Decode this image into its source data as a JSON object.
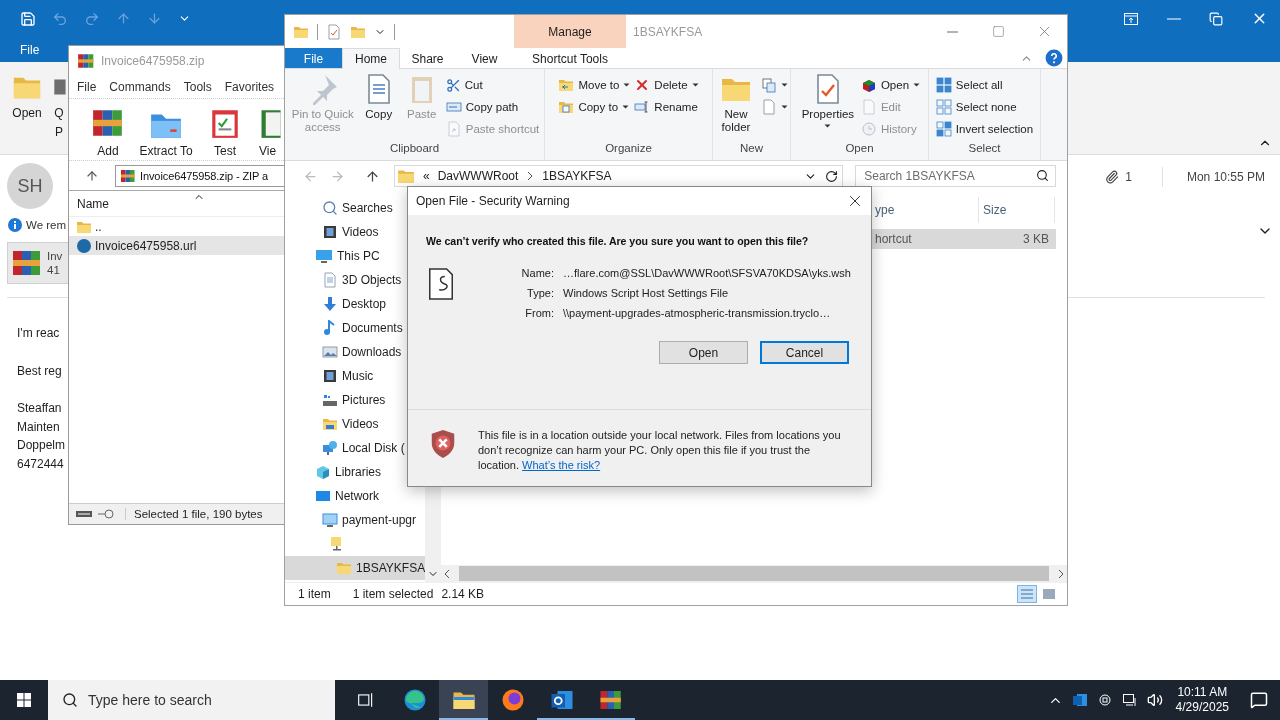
{
  "outlook": {
    "menu_tab": "File",
    "ribbon_buttons": [
      {
        "lines": [
          "Open"
        ]
      },
      {
        "lines": [
          "Q",
          "P"
        ]
      }
    ],
    "message": {
      "sender_initials": "SH",
      "notice": "We rem",
      "attachment": {
        "name": "Inv",
        "size": "41"
      },
      "attachment_count": "1",
      "received": "Mon 10:55 PM",
      "body": [
        [
          "I'm reac"
        ],
        [
          "Best reg"
        ],
        [
          "Steaffan",
          "Mainten",
          "Doppelm",
          "6472444"
        ]
      ]
    }
  },
  "winrar": {
    "title": "Invoice6475958.zip",
    "menu": [
      "File",
      "Commands",
      "Tools",
      "Favorites"
    ],
    "toolbar": [
      "Add",
      "Extract To",
      "Test",
      "Vie"
    ],
    "path": "Invoice6475958.zip - ZIP a",
    "columns": [
      "Name"
    ],
    "rows": [
      {
        "name": "..",
        "selected": false
      },
      {
        "name": "Invoice6475958.url",
        "selected": true
      }
    ],
    "status": "Selected 1 file, 190 bytes"
  },
  "explorer": {
    "context_tab": "Manage",
    "title": "1BSAYKFSA",
    "tabs": [
      {
        "label": "File",
        "kind": "file",
        "selected": false
      },
      {
        "label": "Home",
        "kind": "tab",
        "selected": true
      },
      {
        "label": "Share",
        "kind": "tab",
        "selected": false
      },
      {
        "label": "View",
        "kind": "tab",
        "selected": false
      },
      {
        "label": "Shortcut Tools",
        "kind": "tab",
        "selected": false
      }
    ],
    "groups": [
      {
        "label": "Clipboard",
        "items": [
          {
            "kind": "large",
            "label": "Pin to Quick access",
            "disabled": true
          },
          {
            "kind": "large",
            "label": "Copy",
            "disabled": false
          },
          {
            "kind": "large",
            "label": "Paste",
            "disabled": true
          },
          {
            "kind": "stack",
            "items": [
              {
                "label": "Cut",
                "disabled": false
              },
              {
                "label": "Copy path",
                "disabled": false
              },
              {
                "label": "Paste shortcut",
                "disabled": true
              }
            ]
          }
        ]
      },
      {
        "label": "Organize",
        "items": [
          {
            "kind": "stack",
            "items": [
              {
                "label": "Move to",
                "dropdown": true,
                "disabled": false
              },
              {
                "label": "Copy to",
                "dropdown": true,
                "disabled": false
              }
            ]
          },
          {
            "kind": "stack",
            "items": [
              {
                "label": "Delete",
                "dropdown": true,
                "disabled": false
              },
              {
                "label": "Rename",
                "disabled": false
              }
            ]
          }
        ]
      },
      {
        "label": "New",
        "items": [
          {
            "kind": "large",
            "label": "New folder",
            "disabled": false
          },
          {
            "kind": "stack",
            "items": [
              {
                "dropdown": true,
                "disabled": false
              },
              {
                "dropdown": true,
                "disabled": false
              }
            ]
          }
        ]
      },
      {
        "label": "Open",
        "items": [
          {
            "kind": "large",
            "label": "Properties",
            "dropdown": true,
            "disabled": false
          },
          {
            "kind": "stack",
            "items": [
              {
                "label": "Open",
                "dropdown": true,
                "disabled": false
              },
              {
                "label": "Edit",
                "disabled": true
              },
              {
                "label": "History",
                "disabled": true
              }
            ]
          }
        ]
      },
      {
        "label": "Select",
        "items": [
          {
            "kind": "stack",
            "items": [
              {
                "label": "Select all",
                "disabled": false
              },
              {
                "label": "Select none",
                "disabled": false
              },
              {
                "label": "Invert selection",
                "disabled": false
              }
            ]
          }
        ]
      }
    ],
    "address": {
      "overflow": "«",
      "path": [
        "DavWWWRoot",
        "1BSAYKFSA"
      ]
    },
    "search": {
      "placeholder": "Search 1BSAYKFSA"
    },
    "nav": {
      "upper_items": [
        {
          "label": "Searches",
          "selected": false
        },
        {
          "label": "Videos",
          "selected": false
        }
      ],
      "roots": [
        {
          "label": "This PC",
          "selected": false,
          "children": [
            {
              "label": "3D Objects",
              "selected": false
            },
            {
              "label": "Desktop",
              "selected": false
            },
            {
              "label": "Documents",
              "selected": false
            },
            {
              "label": "Downloads",
              "selected": false
            },
            {
              "label": "Music",
              "selected": false
            },
            {
              "label": "Pictures",
              "selected": false
            },
            {
              "label": "Videos",
              "selected": false
            },
            {
              "label": "Local Disk (",
              "selected": false
            }
          ]
        },
        {
          "label": "Libraries",
          "selected": false
        },
        {
          "label": "Network",
          "selected": false,
          "children": [
            {
              "label": "payment-upgr",
              "selected": false,
              "children": [
                {
                  "selected": false,
                  "children": [
                    {
                      "label": "1BSAYKFSA",
                      "selected": true
                    }
                  ]
                }
              ]
            }
          ]
        }
      ]
    },
    "columns": [
      "ype",
      "Size"
    ],
    "rows": [
      {
        "type": "hortcut",
        "size": "3 KB",
        "selected": true
      }
    ],
    "status": {
      "count": "1 item",
      "selection": "1 item selected",
      "size": "2.14 KB"
    },
    "view_buttons": [
      {
        "selected": true
      },
      {
        "selected": false
      }
    ]
  },
  "dialog": {
    "title": "Open File - Security Warning",
    "heading": "We can’t verify who created this file. Are you sure you want to open this file?",
    "fields": [
      {
        "label": "Name:",
        "value": "…flare.com@SSL\\DavWWWRoot\\SFSVA70KDSA\\yks.wsh"
      },
      {
        "label": "Type:",
        "value": "Windows Script Host Settings File"
      },
      {
        "label": "From:",
        "value": "\\\\payment-upgrades-atmospheric-transmission.tryclo…"
      }
    ],
    "buttons": [
      {
        "label": "Open",
        "default": false
      },
      {
        "label": "Cancel",
        "default": true
      }
    ],
    "warning": "This file is in a location outside your local network. Files from locations you don’t recognize can harm your PC. Only open this file if you trust the location.",
    "link": "What’s the risk?"
  },
  "taskbar": {
    "search": {
      "placeholder": "Type here to search"
    },
    "apps": [
      {
        "selected": false,
        "running": false
      },
      {
        "selected": true,
        "running": true
      },
      {
        "selected": false,
        "running": false
      },
      {
        "selected": false,
        "running": true
      },
      {
        "selected": false,
        "running": true
      }
    ],
    "time": "10:11 AM",
    "date": "4/29/2025"
  }
}
